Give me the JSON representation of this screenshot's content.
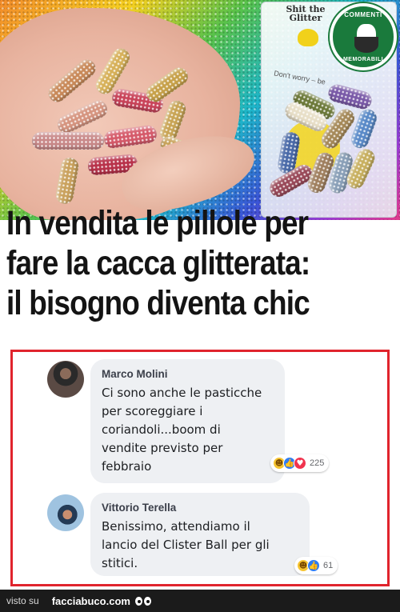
{
  "photo": {
    "bag_title": "Shit the Glitter",
    "bag_note": "Don't worry – be",
    "badge_top": "COMMENTI",
    "badge_bottom": "MEMORABILI"
  },
  "headline": {
    "lines": [
      "In vendita le pillole per",
      "fare la cacca glitterata:",
      "il bisogno diventa chic"
    ]
  },
  "comments": [
    {
      "author": "Marco Molini",
      "text_lines": [
        "Ci sono anche le pasticche",
        "per scoreggiare i",
        "coriandoli...boom di",
        "vendite previsto per",
        "febbraio"
      ],
      "reactions": [
        "haha",
        "like",
        "love"
      ],
      "reaction_count": "225"
    },
    {
      "author": "Vittorio Terella",
      "text_lines": [
        "Benissimo, attendiamo il",
        "lancio del Clister Ball per gli",
        "stitici."
      ],
      "reactions": [
        "haha",
        "like"
      ],
      "reaction_count": "61"
    }
  ],
  "footer": {
    "visto_su": "visto su",
    "site": "facciabuco.com"
  },
  "colors": {
    "panel_border": "#e0242d",
    "bubble_bg": "#eef0f3",
    "footer_bg": "#1b1b1b"
  }
}
